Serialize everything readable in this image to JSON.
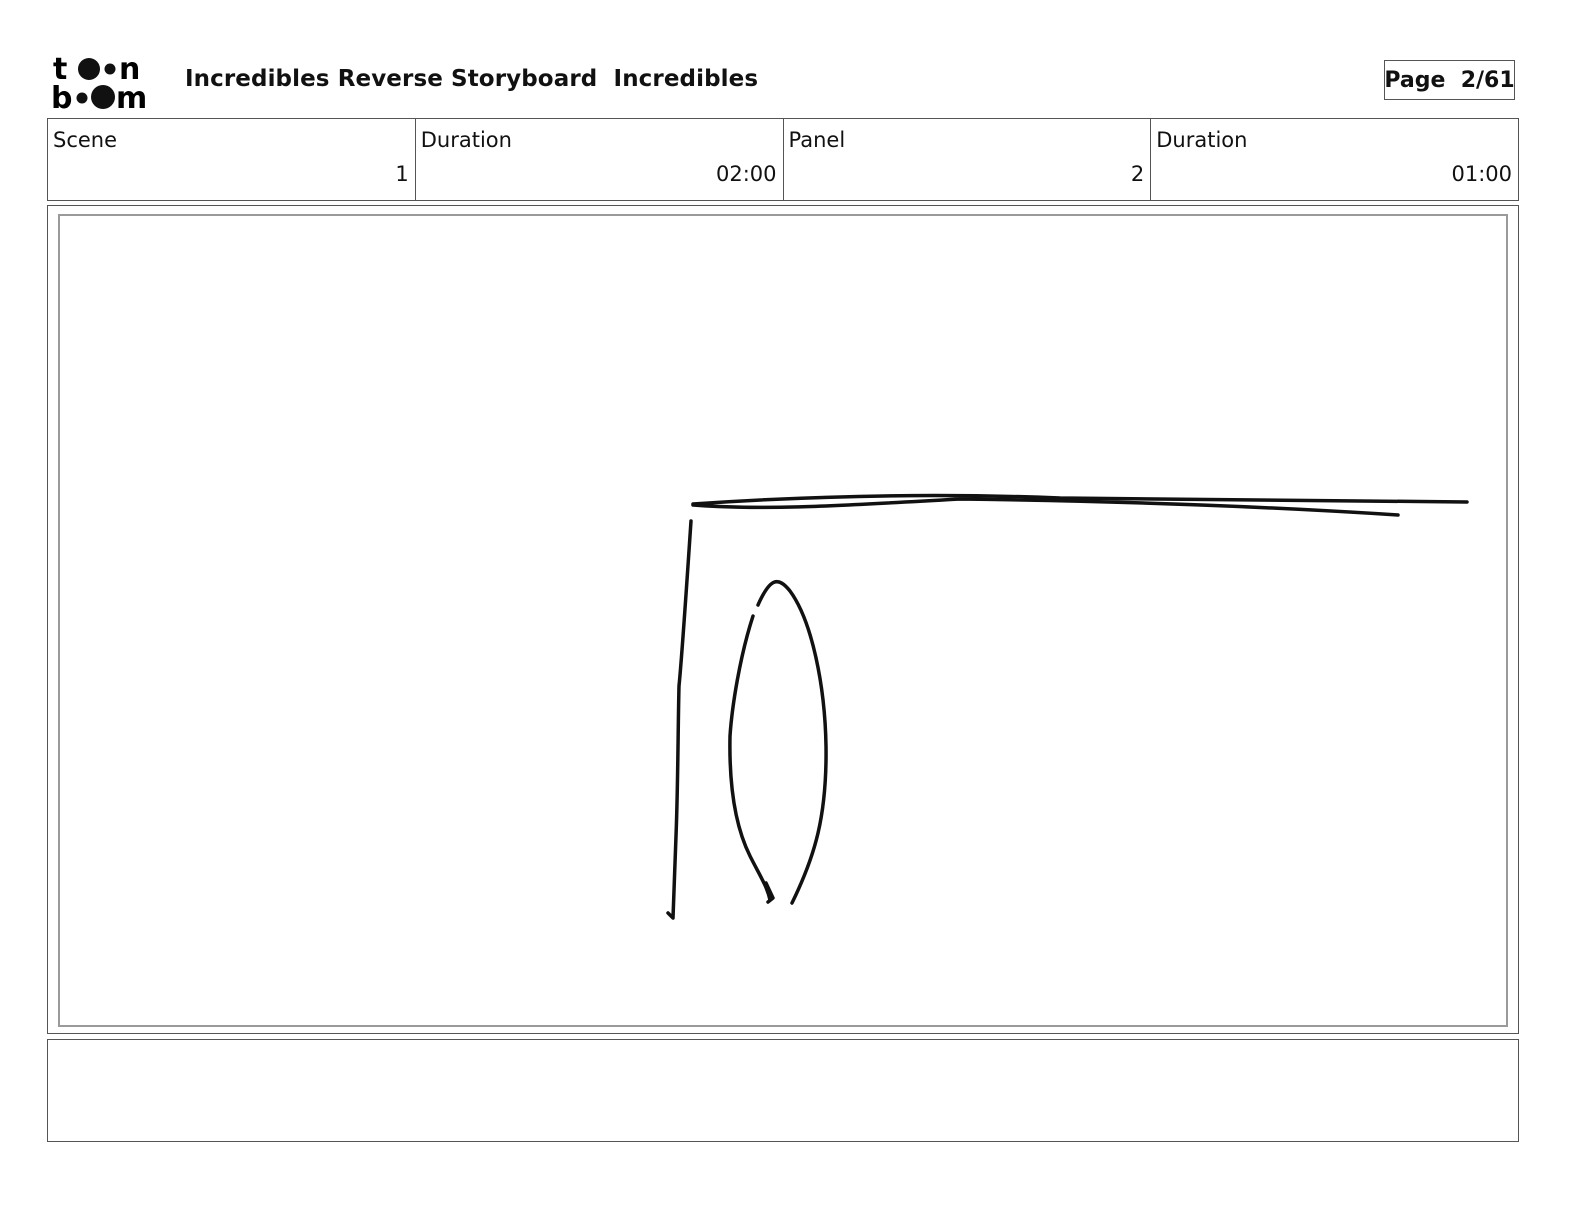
{
  "header": {
    "logo_text": "toon boom",
    "title": "Incredibles Reverse Storyboard  Incredibles",
    "page_label": "Page  2/61"
  },
  "info": {
    "scene_label": "Scene",
    "scene_value": "1",
    "scene_duration_label": "Duration",
    "scene_duration_value": "02:00",
    "panel_label": "Panel",
    "panel_value": "2",
    "panel_duration_label": "Duration",
    "panel_duration_value": "01:00"
  },
  "panel": {
    "sketch": "rough-line-sketch"
  },
  "notes": {
    "text": ""
  }
}
